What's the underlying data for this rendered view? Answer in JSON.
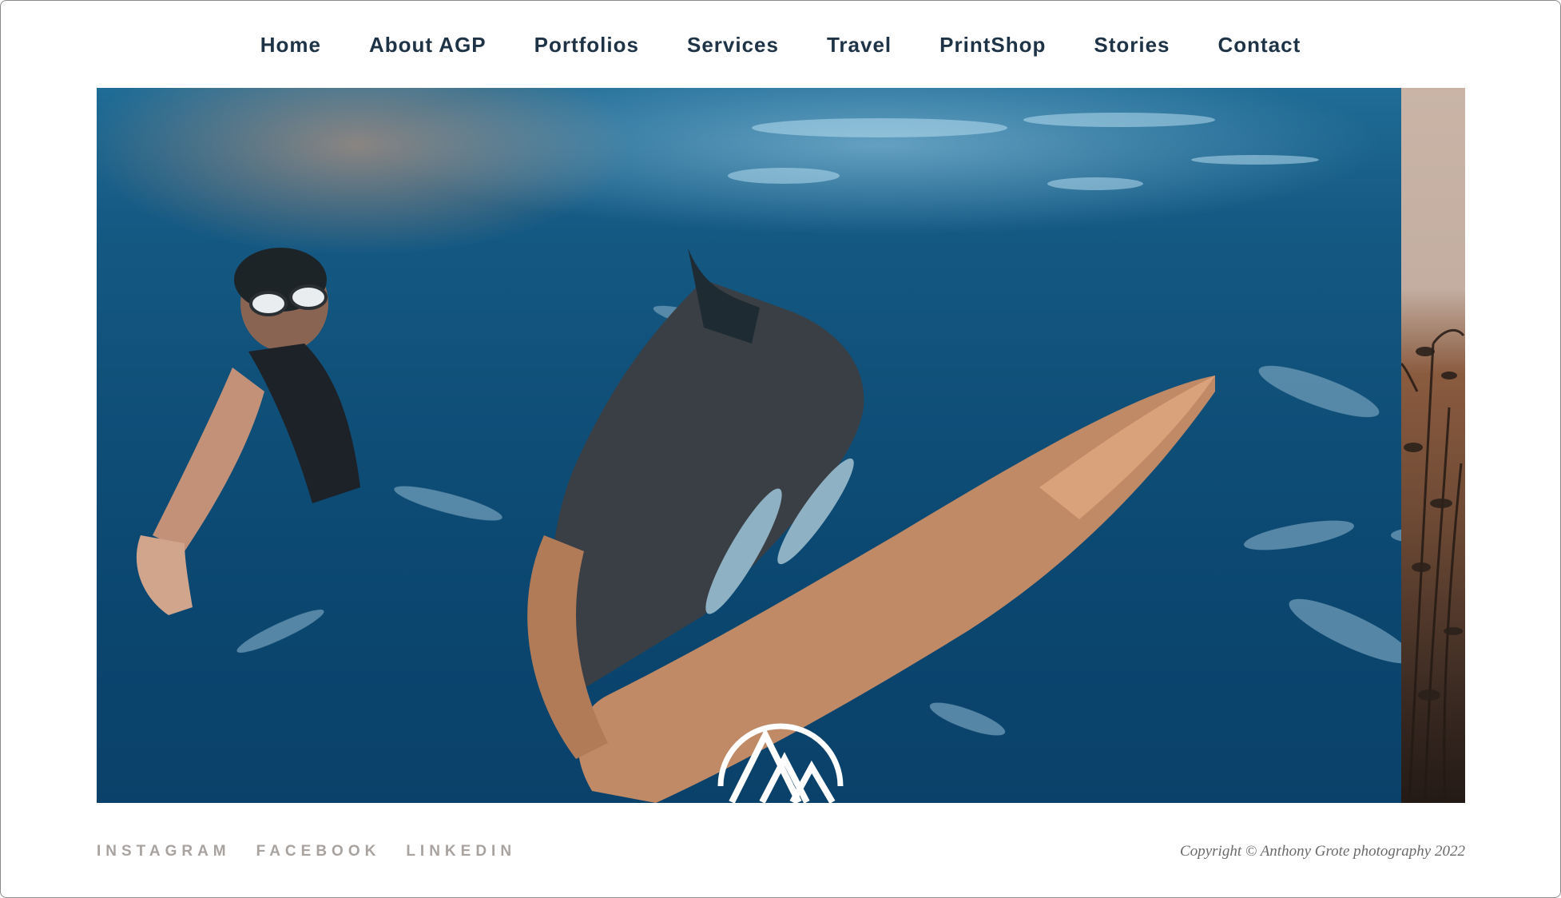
{
  "nav": {
    "items": [
      {
        "label": "Home"
      },
      {
        "label": "About AGP"
      },
      {
        "label": "Portfolios"
      },
      {
        "label": "Services"
      },
      {
        "label": "Travel"
      },
      {
        "label": "PrintShop"
      },
      {
        "label": "Stories"
      },
      {
        "label": "Contact"
      }
    ]
  },
  "hero": {
    "logo_icon": "agp-triangle-logo-icon"
  },
  "footer": {
    "social": [
      {
        "label": "INSTAGRAM"
      },
      {
        "label": "FACEBOOK"
      },
      {
        "label": "LINKEDIN"
      }
    ],
    "copyright": "Copyright © Anthony Grote photography 2022"
  },
  "colors": {
    "nav_text": "#1e3346",
    "social_text": "#a9a3a0",
    "ocean": "#0f4f78"
  }
}
